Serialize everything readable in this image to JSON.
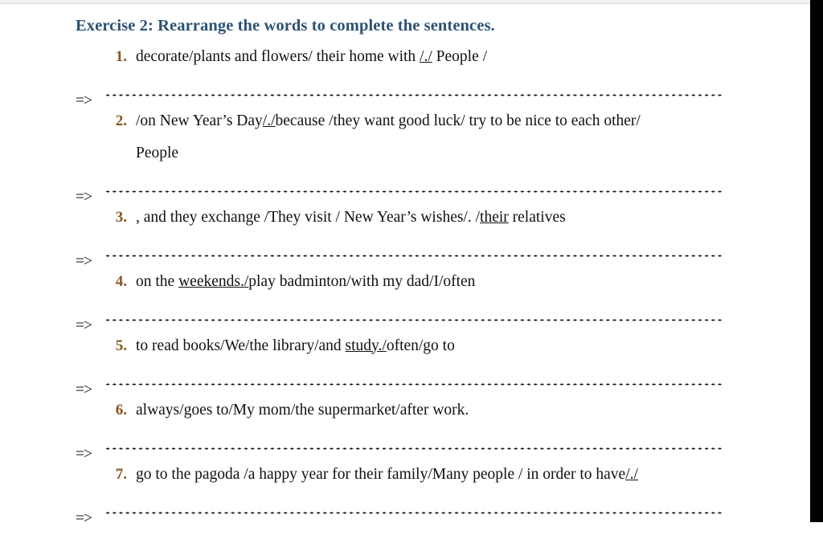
{
  "document": {
    "exercise_title": "Exercise 2: Rearrange the words to complete the sentences.",
    "answer_arrow": "=>",
    "colors": {
      "title": "#2d5273",
      "number": "#86561e",
      "body_text": "#111111",
      "page_background": "#ffffff",
      "right_band": "#000000",
      "top_strip": "#f2f2f2"
    },
    "questions": [
      {
        "number": "1.",
        "parts": [
          {
            "text": "decorate/plants and flowers/ their home with ",
            "underline": false
          },
          {
            "text": "/./",
            "underline": true
          },
          {
            "text": " People /",
            "underline": false
          }
        ],
        "continuation": "",
        "answer_line": ""
      },
      {
        "number": "2.",
        "parts": [
          {
            "text": "/on New Year’s Day",
            "underline": false
          },
          {
            "text": "/./",
            "underline": true
          },
          {
            "text": "because /they want good luck/ try to be nice to each other/",
            "underline": false
          }
        ],
        "continuation": "People",
        "answer_line": ""
      },
      {
        "number": "3.",
        "parts": [
          {
            "text": ", and they exchange /They visit / New Year’s wishes/. /",
            "underline": false
          },
          {
            "text": "their",
            "underline": true
          },
          {
            "text": " relatives",
            "underline": false
          }
        ],
        "continuation": "",
        "answer_line": ""
      },
      {
        "number": "4.",
        "parts": [
          {
            "text": "on the ",
            "underline": false
          },
          {
            "text": "weekends./",
            "underline": true
          },
          {
            "text": "play badminton/with my dad/I/often",
            "underline": false
          }
        ],
        "continuation": "",
        "answer_line": ""
      },
      {
        "number": "5.",
        "parts": [
          {
            "text": "to read books/We/the library/and ",
            "underline": false
          },
          {
            "text": "study./",
            "underline": true
          },
          {
            "text": "often/go to",
            "underline": false
          }
        ],
        "continuation": "",
        "answer_line": ""
      },
      {
        "number": "6.",
        "parts": [
          {
            "text": "always/goes to/My mom/the supermarket/after work.",
            "underline": false
          }
        ],
        "continuation": "",
        "answer_line": ""
      },
      {
        "number": "7.",
        "parts": [
          {
            "text": "go to the pagoda /a happy year for their family/Many people / in order to have",
            "underline": false
          },
          {
            "text": "/./",
            "underline": true
          }
        ],
        "continuation": "",
        "answer_line": ""
      }
    ]
  }
}
